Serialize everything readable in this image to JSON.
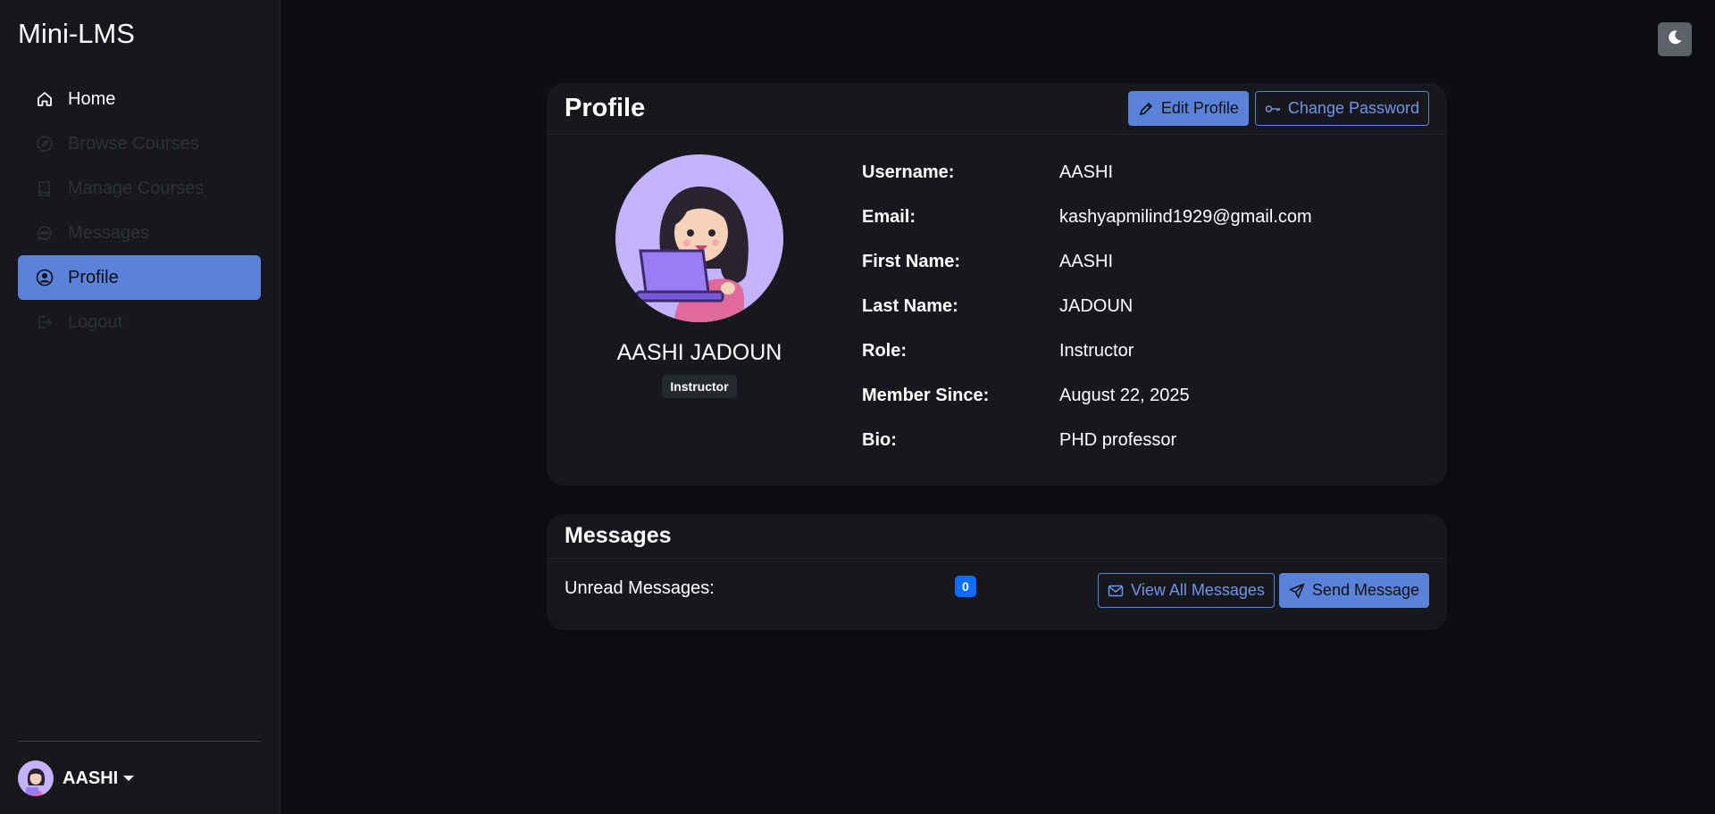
{
  "app": {
    "title": "Mini-LMS"
  },
  "sidebar": {
    "items": [
      {
        "label": "Home",
        "icon": "home-icon",
        "state": "normal"
      },
      {
        "label": "Browse Courses",
        "icon": "compass-icon",
        "state": "disabled"
      },
      {
        "label": "Manage Courses",
        "icon": "book-icon",
        "state": "disabled"
      },
      {
        "label": "Messages",
        "icon": "chat-icon",
        "state": "disabled"
      },
      {
        "label": "Profile",
        "icon": "user-circle-icon",
        "state": "active"
      },
      {
        "label": "Logout",
        "icon": "logout-icon",
        "state": "disabled"
      }
    ],
    "user": {
      "name": "AASHI"
    }
  },
  "profile": {
    "title": "Profile",
    "edit_label": "Edit Profile",
    "change_password_label": "Change Password",
    "full_name": "AASHI JADOUN",
    "role_badge": "Instructor",
    "details": [
      {
        "label": "Username:",
        "value": "AASHI"
      },
      {
        "label": "Email:",
        "value": "kashyapmilind1929@gmail.com"
      },
      {
        "label": "First Name:",
        "value": "AASHI"
      },
      {
        "label": "Last Name:",
        "value": "JADOUN"
      },
      {
        "label": "Role:",
        "value": "Instructor"
      },
      {
        "label": "Member Since:",
        "value": "August 22, 2025"
      },
      {
        "label": "Bio:",
        "value": "PHD professor"
      }
    ]
  },
  "messages": {
    "title": "Messages",
    "unread_label": "Unread Messages:",
    "unread_count": "0",
    "view_all_label": "View All Messages",
    "send_label": "Send Message"
  },
  "colors": {
    "accent": "#5a82d9",
    "background": "#0d0e12",
    "card": "#17181d",
    "badge_blue": "#0d6efd",
    "avatar_bg": "#c4b4ff"
  }
}
